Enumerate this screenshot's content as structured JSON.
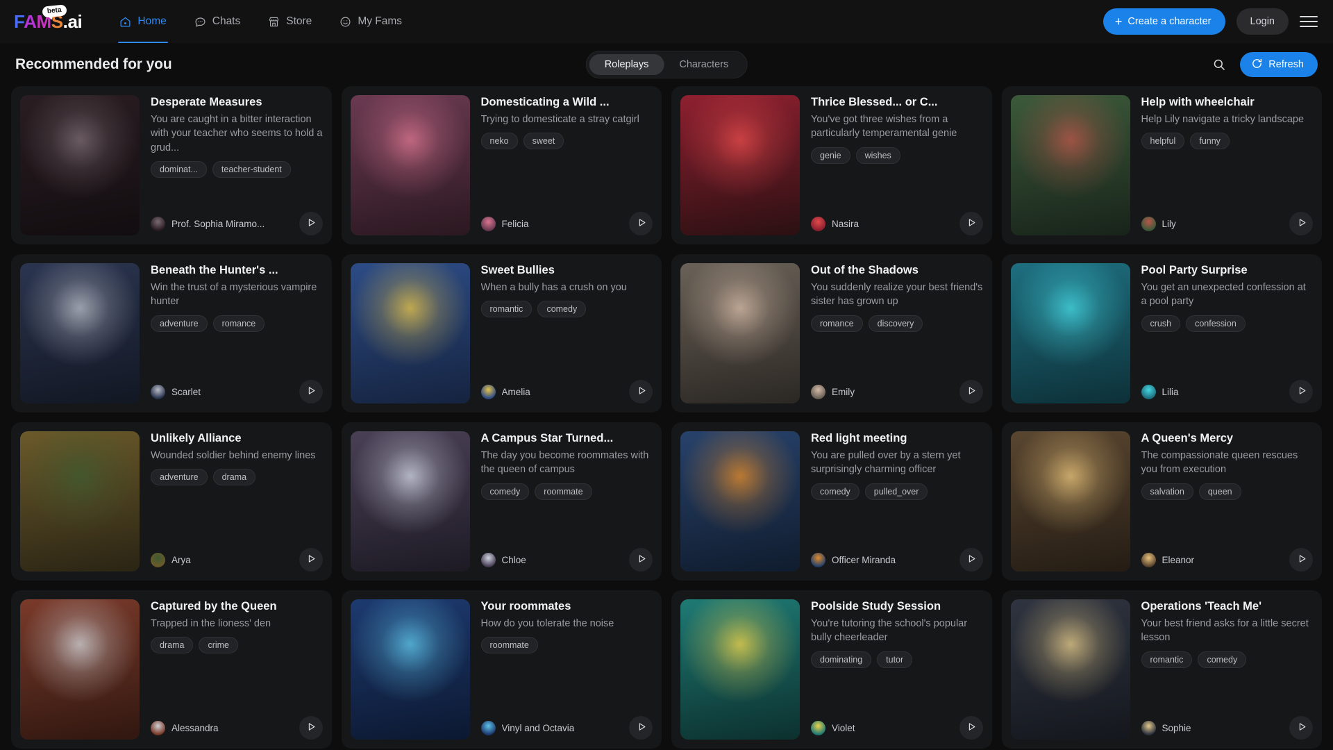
{
  "header": {
    "logo": {
      "f": "F",
      "a": "A",
      "m": "M",
      "s": "S",
      "dot": ".",
      "ai": "ai",
      "beta": "beta"
    },
    "nav": [
      {
        "label": "Home",
        "icon": "home-icon",
        "active": true
      },
      {
        "label": "Chats",
        "icon": "chat-bubble-icon",
        "active": false
      },
      {
        "label": "Store",
        "icon": "store-icon",
        "active": false
      },
      {
        "label": "My Fams",
        "icon": "smiley-icon",
        "active": false
      }
    ],
    "create_label": "Create a character",
    "create_plus": "+",
    "login_label": "Login",
    "menu_icon": "hamburger-icon",
    "accent_color": "#1a82e8"
  },
  "subheader": {
    "title": "Recommended for you",
    "tabs": [
      {
        "label": "Roleplays",
        "active": true
      },
      {
        "label": "Characters",
        "active": false
      }
    ],
    "search_icon": "search-icon",
    "refresh_label": "Refresh",
    "refresh_icon": "refresh-icon"
  },
  "cards": [
    {
      "title": "Desperate Measures",
      "desc": "You are caught in a bitter interaction with your teacher who seems to hold a grud...",
      "tags": [
        "dominat...",
        "teacher-student"
      ],
      "character": "Prof. Sophia Miramo...",
      "thumb": "dark-haired-girl-latex-outfit"
    },
    {
      "title": "Domesticating a Wild ...",
      "desc": "Trying to domesticate a stray catgirl",
      "tags": [
        "neko",
        "sweet"
      ],
      "character": "Felicia",
      "thumb": "catgirl-pink-shirt-window"
    },
    {
      "title": "Thrice Blessed... or C...",
      "desc": "You've got three wishes from a particularly temperamental genie",
      "tags": [
        "genie",
        "wishes"
      ],
      "character": "Nasira",
      "thumb": "red-haired-genie-gold-jewelry"
    },
    {
      "title": "Help with wheelchair",
      "desc": "Help Lily navigate a tricky landscape",
      "tags": [
        "helpful",
        "funny"
      ],
      "character": "Lily",
      "thumb": "red-haired-girl-wheelchair"
    },
    {
      "title": "Beneath the Hunter's ...",
      "desc": "Win the trust of a mysterious vampire hunter",
      "tags": [
        "adventure",
        "romance"
      ],
      "character": "Scarlet",
      "thumb": "white-haired-vampire-hunter-cape"
    },
    {
      "title": "Sweet Bullies",
      "desc": "When a bully has a crush on you",
      "tags": [
        "romantic",
        "comedy"
      ],
      "character": "Amelia",
      "thumb": "blonde-girl-blue-sportswear"
    },
    {
      "title": "Out of the Shadows",
      "desc": "You suddenly realize your best friend's sister has grown up",
      "tags": [
        "romance",
        "discovery"
      ],
      "character": "Emily",
      "thumb": "brown-haired-girl-doorway"
    },
    {
      "title": "Pool Party Surprise",
      "desc": "You get an unexpected confession at a pool party",
      "tags": [
        "crush",
        "confession"
      ],
      "character": "Lilia",
      "thumb": "teal-haired-girl-swimsuit-pool"
    },
    {
      "title": "Unlikely Alliance",
      "desc": "Wounded soldier behind enemy lines",
      "tags": [
        "adventure",
        "drama"
      ],
      "character": "Arya",
      "thumb": "soldier-green-uniform-sunset"
    },
    {
      "title": "A Campus Star Turned...",
      "desc": "The day you become roommates with the queen of campus",
      "tags": [
        "comedy",
        "roommate"
      ],
      "character": "Chloe",
      "thumb": "silver-haired-girl-reading-bed"
    },
    {
      "title": "Red light meeting",
      "desc": "You are pulled over by a stern yet surprisingly charming officer",
      "tags": [
        "comedy",
        "pulled_over"
      ],
      "character": "Officer Miranda",
      "thumb": "police-officer-city-skyline"
    },
    {
      "title": "A Queen's Mercy",
      "desc": "The compassionate queen rescues you from execution",
      "tags": [
        "salvation",
        "queen"
      ],
      "character": "Eleanor",
      "thumb": "dark-haired-queen-cathedral"
    },
    {
      "title": "Captured by the Queen",
      "desc": "Trapped in the lioness' den",
      "tags": [
        "drama",
        "crime"
      ],
      "character": "Alessandra",
      "thumb": "suited-woman-red-tie-street"
    },
    {
      "title": "Your roommates",
      "desc": "How do you tolerate the noise",
      "tags": [
        "roommate"
      ],
      "character": "Vinyl and Octavia",
      "thumb": "two-blue-haired-musicians"
    },
    {
      "title": "Poolside Study Session",
      "desc": "You're tutoring the school's popular bully cheerleader",
      "tags": [
        "dominating",
        "tutor"
      ],
      "character": "Violet",
      "thumb": "blonde-cheerleader-stadium"
    },
    {
      "title": "Operations 'Teach Me'",
      "desc": "Your best friend asks for a little secret lesson",
      "tags": [
        "romantic",
        "comedy"
      ],
      "character": "Sophie",
      "thumb": "blonde-girl-peace-sign-street"
    }
  ]
}
